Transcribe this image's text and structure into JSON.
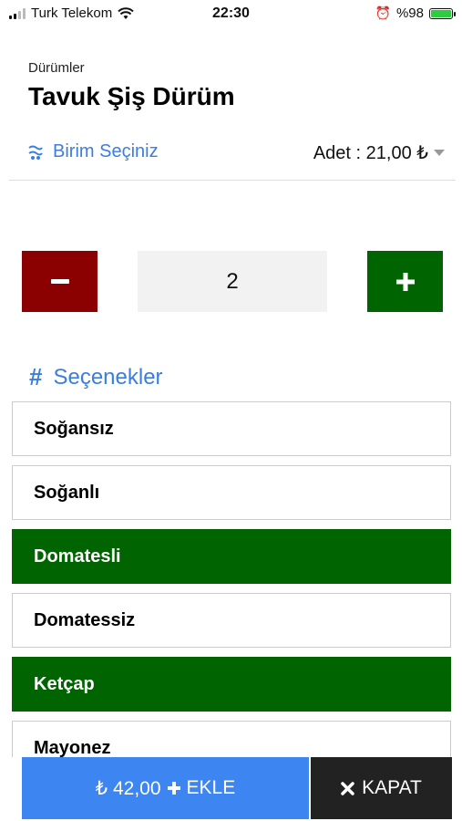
{
  "status_bar": {
    "carrier": "Turk Telekom",
    "time": "22:30",
    "battery_text": "%98",
    "battery_level": 0.98
  },
  "header": {
    "category": "Dürümler",
    "title": "Tavuk Şiş Dürüm"
  },
  "unit": {
    "label": "Birim Seçiniz",
    "adet_label": "Adet : 21,00 ₺"
  },
  "stepper": {
    "quantity": "2"
  },
  "options": {
    "title": "Seçenekler",
    "items": [
      {
        "label": "Soğansız",
        "selected": false
      },
      {
        "label": "Soğanlı",
        "selected": false
      },
      {
        "label": "Domatesli",
        "selected": true
      },
      {
        "label": "Domatessiz",
        "selected": false
      },
      {
        "label": "Ketçap",
        "selected": true
      },
      {
        "label": "Mayonez",
        "selected": false
      }
    ]
  },
  "footer": {
    "add_price": "₺ 42,00",
    "add_label": "EKLE",
    "close_label": "KAPAT"
  },
  "colors": {
    "accent_blue": "#3d85f0",
    "minus_red": "#8b0000",
    "plus_green": "#006400",
    "selected_green": "#006400"
  }
}
